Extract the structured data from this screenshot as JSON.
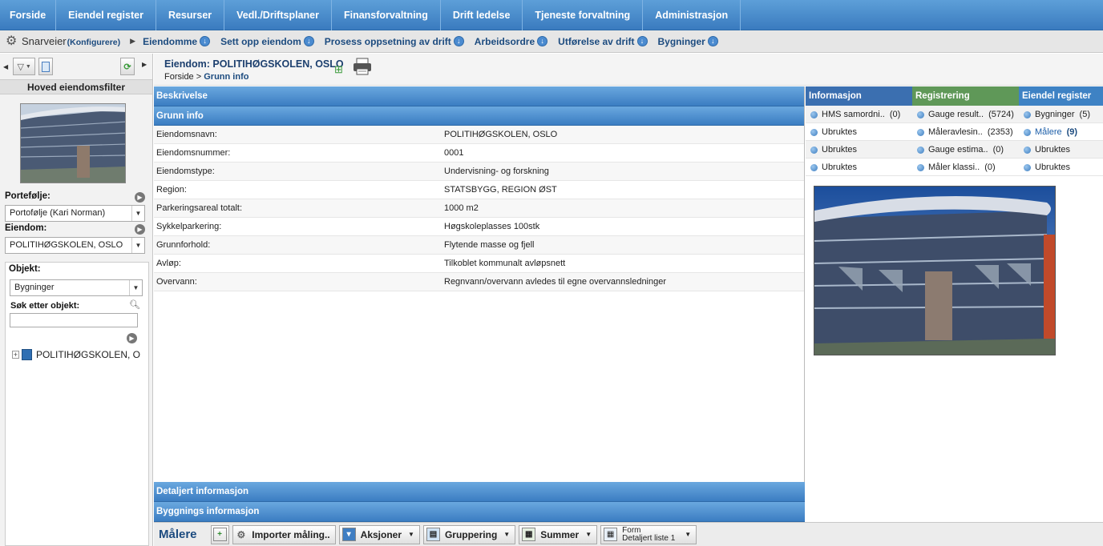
{
  "topnav": [
    "Forside",
    "Eiendel register",
    "Resurser",
    "Vedl./Driftsplaner",
    "Finansforvaltning",
    "Drift ledelse",
    "Tjeneste forvaltning",
    "Administrasjon"
  ],
  "shortcuts": {
    "label": "Snarveier",
    "configure": "(Konfigurere)",
    "items": [
      "Eiendomme",
      "Sett opp eiendom",
      "Prosess oppsetning av drift",
      "Arbeidsordre",
      "Utførelse av drift",
      "Bygninger"
    ]
  },
  "left": {
    "filter_title": "Hoved eiendomsfilter",
    "portfolio_label": "Portefølje:",
    "portfolio_value": "Portofølje (Kari Norman)",
    "property_label": "Eiendom:",
    "property_value": "POLITIHØGSKOLEN, OSLO",
    "object_label": "Objekt:",
    "object_value": "Bygninger",
    "search_label": "Søk etter objekt:",
    "search_value": "",
    "tree_item": "POLITIHØGSKOLEN, O"
  },
  "header": {
    "title": "Eiendom: POLITIHØGSKOLEN, OSLO",
    "crumb_home": "Forside",
    "crumb_sep": ">",
    "crumb_current": "Grunn info"
  },
  "main": {
    "section_beskrivelse": "Beskrivelse",
    "section_grunn": "Grunn info",
    "rows": [
      {
        "k": "Eiendomsnavn:",
        "v": "POLITIHØGSKOLEN, OSLO"
      },
      {
        "k": "Eiendomsnummer:",
        "v": "0001"
      },
      {
        "k": "Eiendomstype:",
        "v": "Undervisning- og forskning"
      },
      {
        "k": "Region:",
        "v": "STATSBYGG, REGION ØST"
      },
      {
        "k": "Parkeringsareal totalt:",
        "v": "1000 m2"
      },
      {
        "k": "Sykkelparkering:",
        "v": "Høgskoleplasses 100stk"
      },
      {
        "k": "Grunnforhold:",
        "v": "Flytende masse og fjell"
      },
      {
        "k": "Avløp:",
        "v": "Tilkoblet kommunalt avløpsnett"
      },
      {
        "k": "Overvann:",
        "v": "Regnvann/overvann avledes til egne overvannsledninger"
      }
    ],
    "section_detaljert": "Detaljert informasjon",
    "section_bygning": "Byggnings informasjon"
  },
  "right": {
    "headers": [
      "Informasjon",
      "Registrering",
      "Eiendel register"
    ],
    "header_colors": [
      "#3b6fb0",
      "#5f9858",
      "#3e82c4"
    ],
    "col1": [
      {
        "t": "HMS samordni..",
        "c": "(0)"
      },
      {
        "t": "Ubruktes",
        "c": ""
      },
      {
        "t": "Ubruktes",
        "c": ""
      },
      {
        "t": "Ubruktes",
        "c": ""
      }
    ],
    "col2": [
      {
        "t": "Gauge result..",
        "c": "(5724)"
      },
      {
        "t": "Måleravlesin..",
        "c": "(2353)"
      },
      {
        "t": "Gauge estima..",
        "c": "(0)"
      },
      {
        "t": "Måler klassi..",
        "c": "(0)"
      }
    ],
    "col3": [
      {
        "t": "Bygninger",
        "c": "(5)"
      },
      {
        "t": "Målere",
        "c": "(9)"
      },
      {
        "t": "Ubruktes",
        "c": ""
      },
      {
        "t": "Ubruktes",
        "c": ""
      }
    ]
  },
  "bottom": {
    "title": "Målere",
    "import": "Importer måling..",
    "actions": "Aksjoner",
    "grouping": "Gruppering",
    "sums": "Summer",
    "form_label": "Form",
    "form_value": "Detaljert liste 1"
  }
}
